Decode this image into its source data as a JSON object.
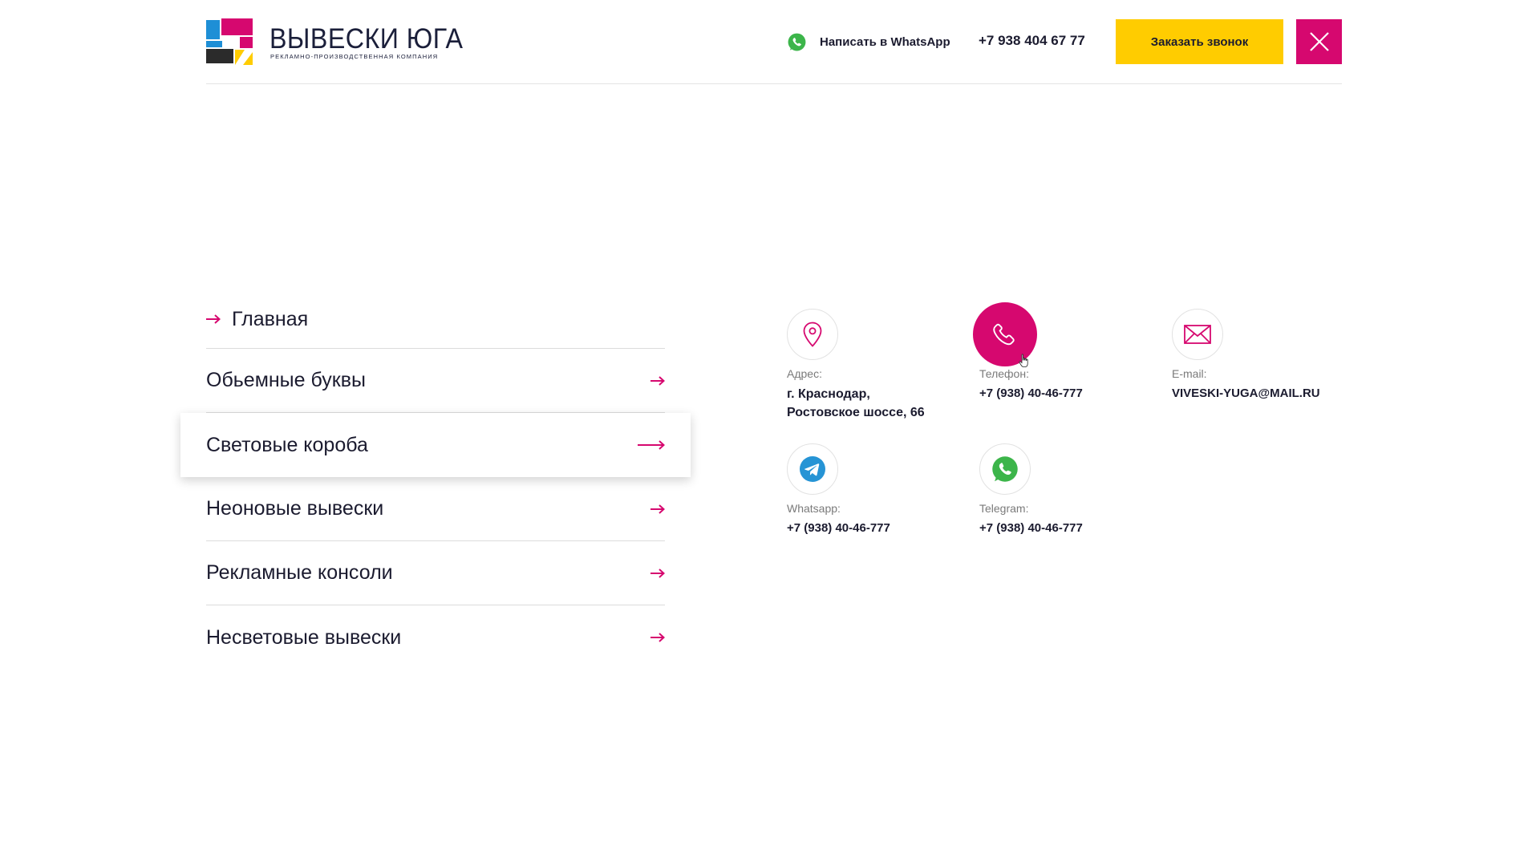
{
  "brand": {
    "title": "ВЫВЕСКИ ЮГА",
    "subtitle": "рекламно-производственная компания",
    "colors": {
      "blue": "#1e8fd6",
      "magenta": "#d6086f",
      "yellow": "#ffcc00",
      "dark": "#2b2b2b"
    }
  },
  "header": {
    "whatsapp_label": "Написать в WhatsApp",
    "phone": "+7 938 404 67 77",
    "callback_label": "Заказать звонок",
    "close_icon": "close-icon"
  },
  "nav": {
    "home_label": "Главная",
    "items": [
      {
        "label": "Обьемные буквы",
        "active": false
      },
      {
        "label": "Световые короба",
        "active": true
      },
      {
        "label": "Неоновые вывески",
        "active": false
      },
      {
        "label": "Рекламные консоли",
        "active": false
      },
      {
        "label": "Несветовые вывески",
        "active": false
      }
    ]
  },
  "contacts": {
    "address": {
      "label": "Адрес:",
      "line1": "г. Краснодар,",
      "line2": "Ростовское шоссе, 66",
      "icon": "map-pin-icon"
    },
    "phone": {
      "label": "Телефон:",
      "value": "+7 (938) 40-46-777",
      "icon": "phone-icon"
    },
    "email": {
      "label": "E-mail:",
      "value": "VIVESKI-YUGA@MAIL.RU",
      "icon": "mail-icon"
    },
    "whatsapp": {
      "label": "Whatsapp:",
      "value": "+7 (938) 40-46-777",
      "icon": "telegram-icon"
    },
    "telegram": {
      "label": "Telegram:",
      "value": "+7 (938) 40-46-777",
      "icon": "whatsapp-icon"
    }
  },
  "colors": {
    "accent": "#d6086f",
    "button": "#ffcc00",
    "text": "#1b1b2f",
    "muted": "#7a7a7a",
    "whatsapp": "#3cb54a",
    "telegram": "#2694d5"
  }
}
